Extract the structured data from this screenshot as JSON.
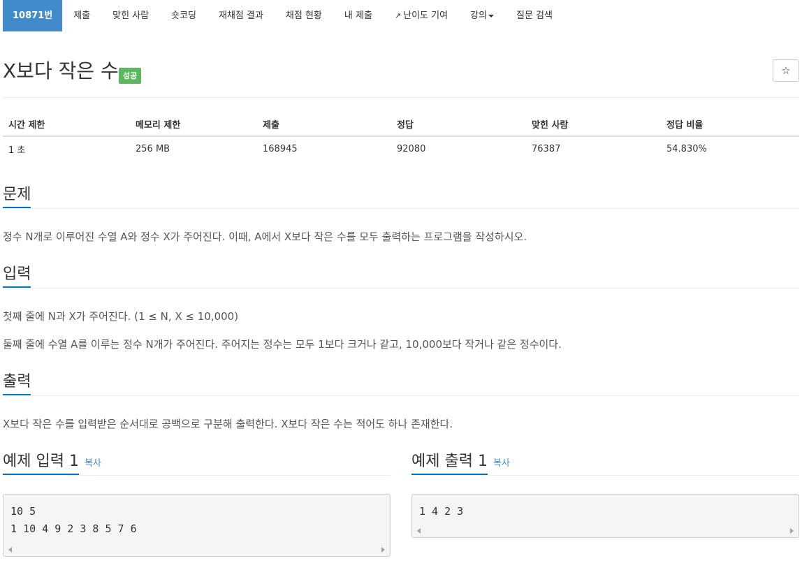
{
  "nav": {
    "tabs": [
      {
        "label": "10871번",
        "active": true
      },
      {
        "label": "제출"
      },
      {
        "label": "맞힌 사람"
      },
      {
        "label": "숏코딩"
      },
      {
        "label": "재채점 결과"
      },
      {
        "label": "채점 현황"
      },
      {
        "label": "내 제출"
      },
      {
        "label": "난이도 기여",
        "icon": "external-link-icon"
      },
      {
        "label": "강의",
        "icon": "caret-down-icon"
      },
      {
        "label": "질문 검색"
      }
    ]
  },
  "problem": {
    "title": "X보다 작은 수",
    "badge": "성공",
    "star_icon": "☆"
  },
  "info_table": {
    "headers": [
      "시간 제한",
      "메모리 제한",
      "제출",
      "정답",
      "맞힌 사람",
      "정답 비율"
    ],
    "values": [
      "1 초",
      "256 MB",
      "168945",
      "92080",
      "76387",
      "54.830%"
    ]
  },
  "sections": {
    "problem": {
      "heading": "문제",
      "text": "정수 N개로 이루어진 수열 A와 정수 X가 주어진다. 이때, A에서 X보다 작은 수를 모두 출력하는 프로그램을 작성하시오."
    },
    "input": {
      "heading": "입력",
      "lines": [
        "첫째 줄에 N과 X가 주어진다. (1 ≤ N, X ≤ 10,000)",
        "둘째 줄에 수열 A를 이루는 정수 N개가 주어진다. 주어지는 정수는 모두 1보다 크거나 같고, 10,000보다 작거나 같은 정수이다."
      ]
    },
    "output": {
      "heading": "출력",
      "text": "X보다 작은 수를 입력받은 순서대로 공백으로 구분해 출력한다. X보다 작은 수는 적어도 하나 존재한다."
    }
  },
  "samples": {
    "input": {
      "heading": "예제 입력 1",
      "copy": "복사",
      "lines": [
        "10 5",
        "1 10 4 9 2 3 8 5 7 6"
      ]
    },
    "output": {
      "heading": "예제 출력 1",
      "copy": "복사",
      "lines": [
        "1 4 2 3"
      ]
    }
  },
  "colors": {
    "accent": "#428bca",
    "success": "#5cb85c",
    "underline": "#0076c0"
  }
}
